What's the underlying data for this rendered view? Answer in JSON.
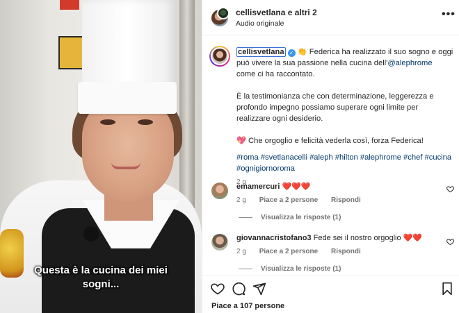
{
  "video": {
    "caption_line1": "Questa è la cucina dei miei",
    "caption_line2": "sogni..."
  },
  "header": {
    "title": "cellisvetlana e altri 2",
    "subtitle": "Audio originale",
    "more_icon": "•••"
  },
  "post": {
    "username": "cellisvetlana",
    "verified_icon": "✓",
    "intro_emoji": "👏",
    "p1_before": " Federica ha realizzato il suo sogno e oggi può vivere la sua passione nella cucina dell'",
    "mention": "@alephrome",
    "p1_after": " come ci ha raccontato.",
    "p2": "È la testimonianza che con determinazione, leggerezza e profondo impegno possiamo superare ogni limite per realizzare ogni desiderio.",
    "p3": "💖 Che orgoglio e felicità vederla così, forza Federica!",
    "hashtags": "#roma #svetlanacelli #aleph #hilton #alephrome #chef #cucina #ognigiornoroma",
    "time": "2 g"
  },
  "comments": [
    {
      "username": "emamercuri",
      "text": "❤️❤️❤️",
      "time": "2 g",
      "likes": "Piace a 2 persone",
      "reply": "Rispondi",
      "view_replies": "Visualizza le risposte (1)"
    },
    {
      "username": "giovannacristofano3",
      "text": "Fede sei il nostro orgoglio ❤️❤️",
      "time": "2 g",
      "likes": "Piace a 2 persone",
      "reply": "Rispondi",
      "view_replies": "Visualizza le risposte (1)"
    }
  ],
  "footer": {
    "likes": "Piace a 107 persone"
  }
}
